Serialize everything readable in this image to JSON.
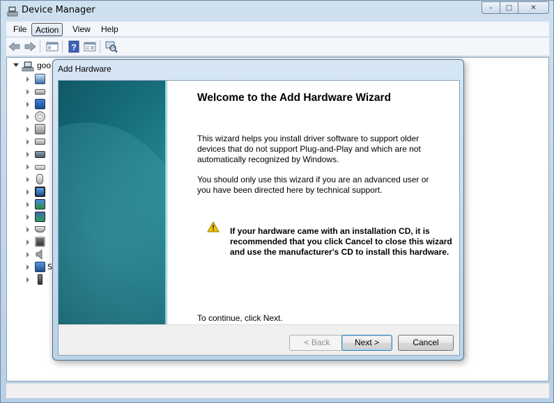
{
  "window": {
    "title": "Device Manager",
    "caption_buttons": {
      "minimize": "–",
      "maximize": "□",
      "close": "✕"
    }
  },
  "menu": [
    "File",
    "Action",
    "View",
    "Help"
  ],
  "tree": {
    "root_label": "goo",
    "row_letters": [
      "",
      "",
      "",
      "",
      "",
      "",
      "",
      "",
      "",
      "",
      "",
      "",
      "",
      "",
      "",
      "S",
      "",
      ""
    ]
  },
  "dialog": {
    "title": "Add Hardware",
    "heading": "Welcome to the Add Hardware Wizard",
    "paragraph1": "This wizard helps you install driver software to support older devices that do not support Plug-and-Play and which are not automatically recognized by Windows.",
    "paragraph2": "You should only use this wizard if you are an advanced user or you have been directed here by technical support.",
    "warning": "If your hardware came with an installation CD, it is recommended that you click Cancel to close this wizard and use the manufacturer's CD to install this hardware.",
    "continue_text": "To continue, click Next.",
    "buttons": {
      "back": "< Back",
      "next": "Next >",
      "cancel": "Cancel"
    }
  },
  "colors": {
    "banner": "#18707e",
    "warning": "#f2c300",
    "accent": "#3c7fb1"
  }
}
